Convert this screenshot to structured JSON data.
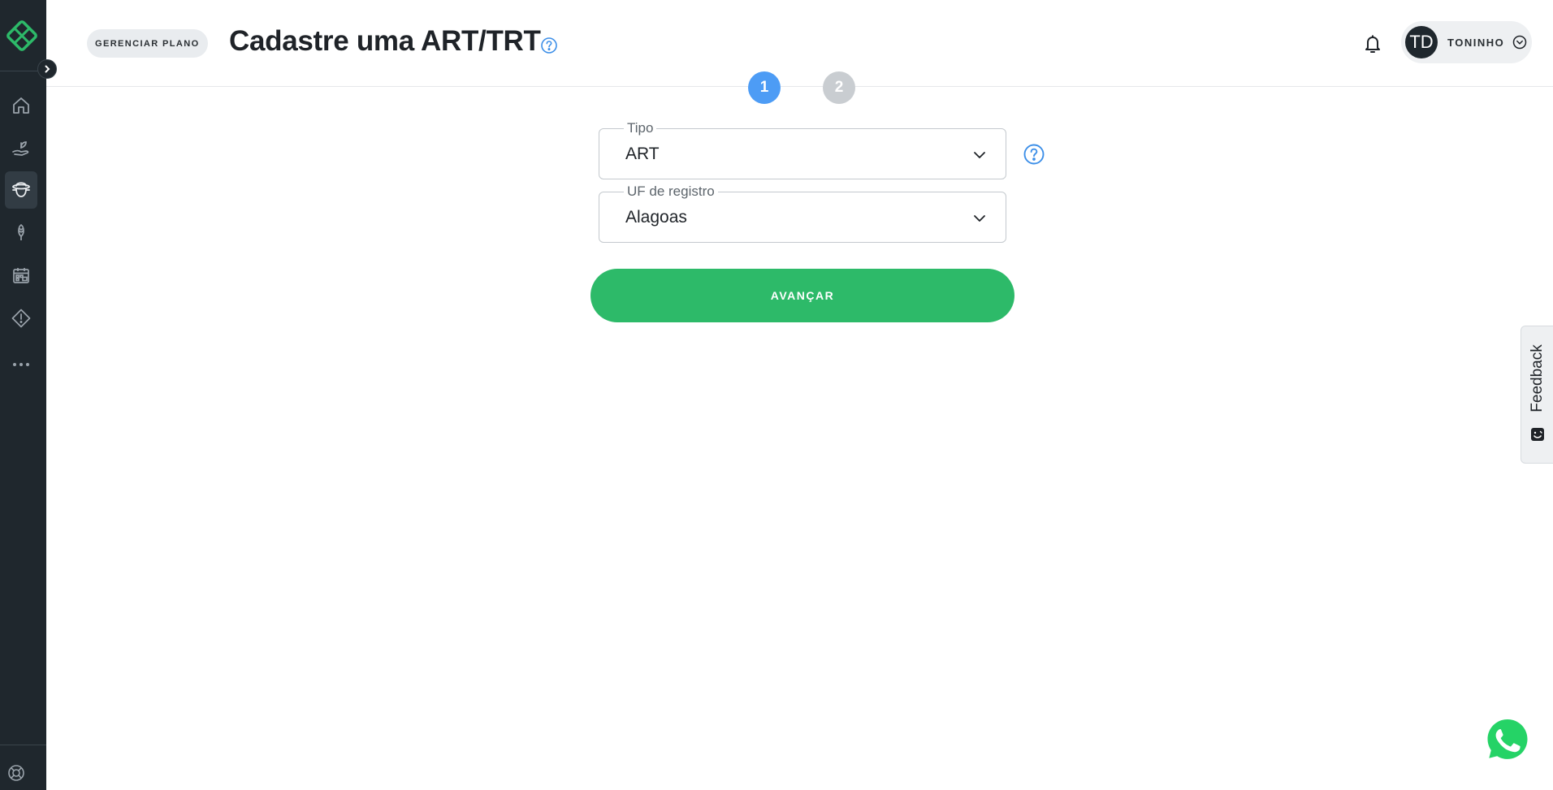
{
  "sidebar": {
    "logo": "leaf-logo",
    "collapse_icon": "chevron-right-icon",
    "items": [
      {
        "icon": "home-icon",
        "active": false
      },
      {
        "icon": "hand-plant-icon",
        "active": false
      },
      {
        "icon": "farmer-icon",
        "active": true
      },
      {
        "icon": "grain-icon",
        "active": false
      },
      {
        "icon": "calendar-icon",
        "active": false
      },
      {
        "icon": "warning-diamond-icon",
        "active": false
      },
      {
        "icon": "more-icon",
        "active": false
      }
    ],
    "help_icon": "lifebuoy-icon"
  },
  "header": {
    "plan_button": "GERENCIAR PLANO",
    "title": "Cadastre uma ART/TRT",
    "title_help_icon": "question-circle-icon",
    "notification_icon": "bell-icon",
    "user": {
      "initials": "TD",
      "name": "TONINHO",
      "menu_icon": "chevron-down-circle-icon"
    }
  },
  "stepper": {
    "steps": [
      {
        "label": "1",
        "active": true
      },
      {
        "label": "2",
        "active": false
      }
    ]
  },
  "form": {
    "tipo": {
      "label": "Tipo",
      "value": "ART"
    },
    "uf": {
      "label": "UF de registro",
      "value": "Alagoas"
    },
    "submit": "AVANÇAR"
  },
  "feedback": {
    "label": "Feedback",
    "icon": "smile-box-icon"
  },
  "whatsapp": {
    "icon": "whatsapp-icon"
  },
  "colors": {
    "sidebar_bg": "#1f272d",
    "brand_green": "#2dba69",
    "step_active": "#4d9cf5",
    "step_inactive": "#c9cdd1",
    "help_blue": "#3d8fe8",
    "whatsapp_green": "#25d366"
  }
}
